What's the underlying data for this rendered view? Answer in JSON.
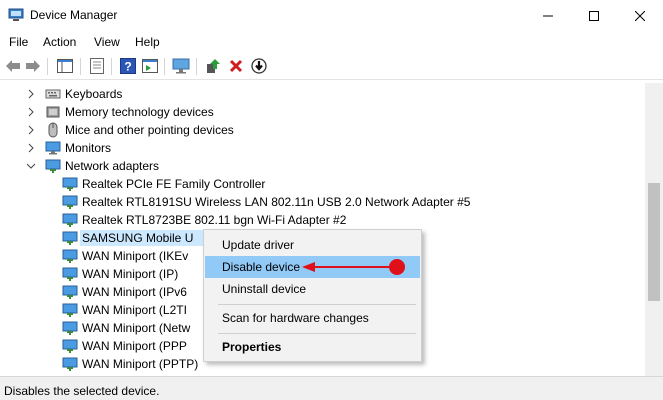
{
  "window": {
    "title": "Device Manager",
    "minimize_icon": "minimize-icon",
    "maximize_icon": "maximize-icon",
    "close_icon": "close-icon"
  },
  "menu": [
    "File",
    "Action",
    "View",
    "Help"
  ],
  "toolbar_icons": [
    "back-arrow-icon",
    "forward-arrow-icon",
    "show-hide-console-tree-icon",
    "properties-icon",
    "help-icon",
    "action-pane-icon",
    "monitor-icon",
    "update-driver-icon",
    "uninstall-x-icon",
    "download-circle-icon"
  ],
  "tree": {
    "categories": [
      {
        "label": "Keyboards",
        "icon": "keyboard-icon",
        "expanded": false
      },
      {
        "label": "Memory technology devices",
        "icon": "memory-icon",
        "expanded": false
      },
      {
        "label": "Mice and other pointing devices",
        "icon": "mouse-icon",
        "expanded": false
      },
      {
        "label": "Monitors",
        "icon": "monitor-icon",
        "expanded": false
      },
      {
        "label": "Network adapters",
        "icon": "network-adapter-icon",
        "expanded": true
      }
    ],
    "network_devices": [
      "Realtek PCIe FE Family Controller",
      "Realtek RTL8191SU Wireless LAN 802.11n USB 2.0 Network Adapter #5",
      "Realtek RTL8723BE 802.11 bgn Wi-Fi Adapter #2",
      "SAMSUNG Mobile U",
      "WAN Miniport (IKEv",
      "WAN Miniport (IP)",
      "WAN Miniport (IPv6",
      "WAN Miniport (L2TI",
      "WAN Miniport (Netw",
      "WAN Miniport (PPP",
      "WAN Miniport (PPTP)"
    ],
    "selected_device": "SAMSUNG Mobile U"
  },
  "context_menu": {
    "items": [
      "Update driver",
      "Disable device",
      "Uninstall device",
      "Scan for hardware changes",
      "Properties"
    ],
    "highlighted": "Disable device",
    "highlight_color": "#91c9f7",
    "annotation_arrow_color": "#e0101a"
  },
  "status": {
    "text": "Disables the selected device."
  }
}
